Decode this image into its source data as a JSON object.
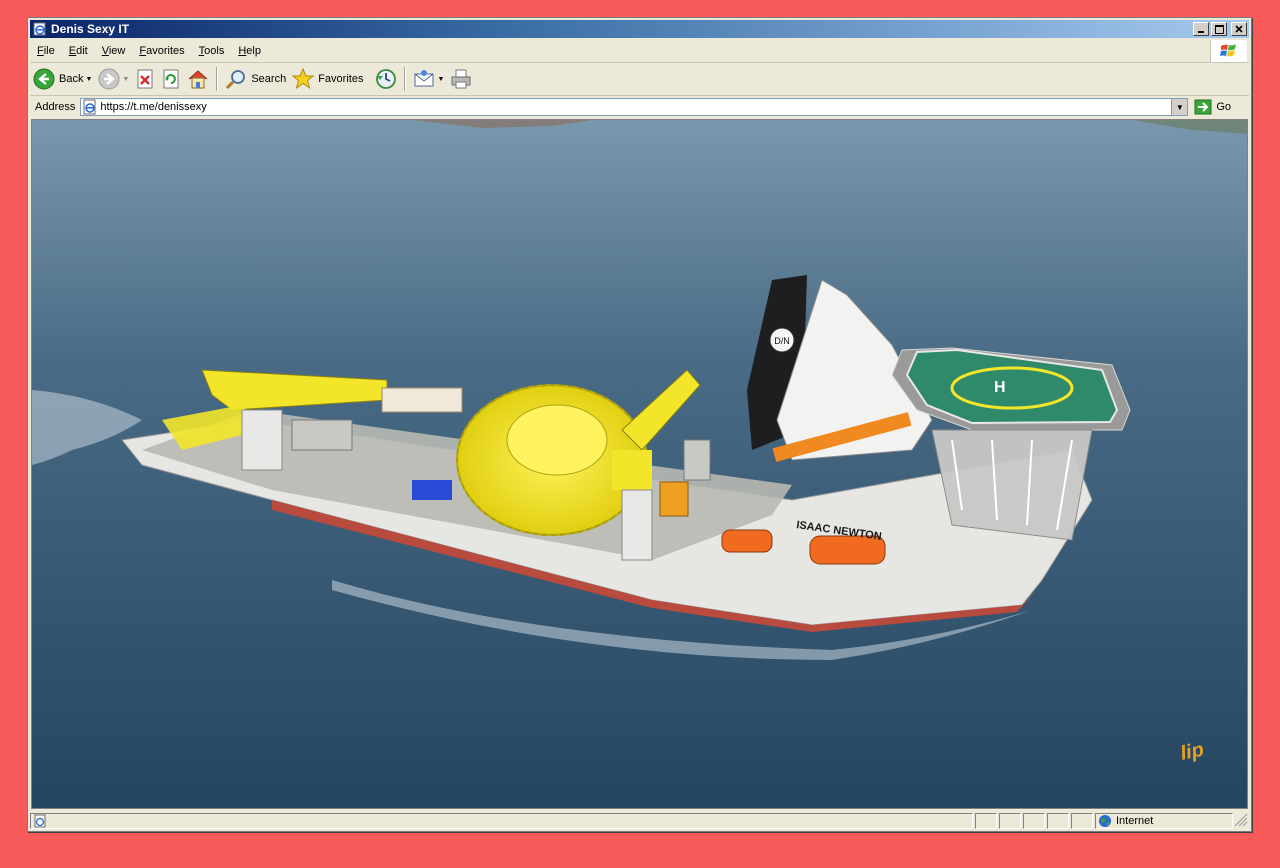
{
  "window": {
    "title": "Denis Sexy IT"
  },
  "menu": {
    "items": [
      {
        "first": "F",
        "rest": "ile"
      },
      {
        "first": "E",
        "rest": "dit"
      },
      {
        "first": "V",
        "rest": "iew"
      },
      {
        "first": "F",
        "rest": "avorites"
      },
      {
        "first": "T",
        "rest": "ools"
      },
      {
        "first": "H",
        "rest": "elp"
      }
    ]
  },
  "toolbar": {
    "back_label": "Back",
    "search_label": "Search",
    "favorites_label": "Favorites"
  },
  "address": {
    "label": "Address",
    "value": "https://t.me/denissexy",
    "go_label": "Go"
  },
  "content": {
    "ship_name": "ISAAC NEWTON",
    "helipad_mark": "H",
    "funnel_logo": "D/N",
    "watermark": "lip"
  },
  "status": {
    "zone_label": "Internet"
  },
  "colors": {
    "title_start": "#0a246a",
    "title_end": "#a6caf0",
    "chrome": "#ece9d8",
    "frame": "#f85a5a",
    "sea": "#3e5f77",
    "hull": "#e6e6e2",
    "hull_bottom": "#b84a3e",
    "deck_yellow": "#f2e52a",
    "helipad": "#2e8a6a"
  }
}
